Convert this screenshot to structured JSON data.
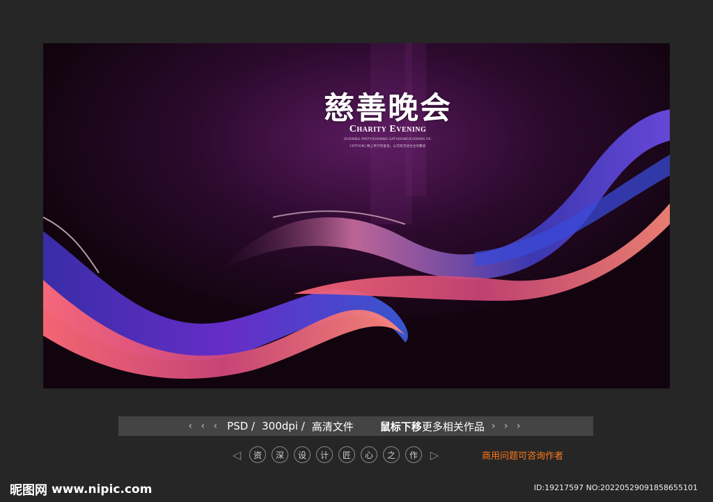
{
  "poster": {
    "title_cn": "慈善晚会",
    "title_en": "Charity Evening",
    "small_text_1": "[EVENING PARTY/EVENING GATHERING/EVENING RE-",
    "small_text_2": "CEPTION] 晚上举行的宴会，以交际活动为主的聚会"
  },
  "info_bar": {
    "left_arrows": "‹ ‹ ‹",
    "format": "PSD /",
    "dpi": "300dpi /",
    "quality": "高清文件",
    "hover_hint_bold": "鼠标下移",
    "hover_hint_rest": "更多相关作品",
    "right_arrows": "› › ›"
  },
  "nav": {
    "prev_icon": "◁",
    "chars": [
      "资",
      "深",
      "设",
      "计",
      "匠",
      "心",
      "之",
      "作"
    ],
    "next_icon": "▷"
  },
  "contact_text": "商用问题可咨询作者",
  "logo": {
    "brand": "昵图网",
    "site": "www.nipic.com"
  },
  "id_text": "ID:19217597 NO:20220529091858655101",
  "colors": {
    "background": "#262626",
    "info_bar": "#444444",
    "contact": "#ff7a1a"
  }
}
